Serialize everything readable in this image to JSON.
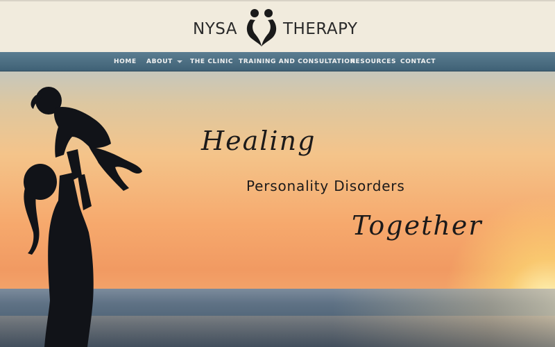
{
  "site": {
    "name_left": "NYSA",
    "name_right": "THERAPY",
    "logo_icon": "two-figures-heart-icon"
  },
  "nav": {
    "items": [
      {
        "label": "HOME"
      },
      {
        "label": "ABOUT",
        "has_dropdown": true
      },
      {
        "label": "THE CLINIC"
      },
      {
        "label": "TRAINING AND CONSULTATION"
      },
      {
        "label": "RESOURCES"
      },
      {
        "label": "CONTACT"
      }
    ],
    "bar_color": "#4a6d82"
  },
  "hero": {
    "line1": "Healing",
    "line2": "Personality Disorders",
    "line3": "Together",
    "image": "mother-lifting-child-silhouette-at-sunset-beach"
  }
}
